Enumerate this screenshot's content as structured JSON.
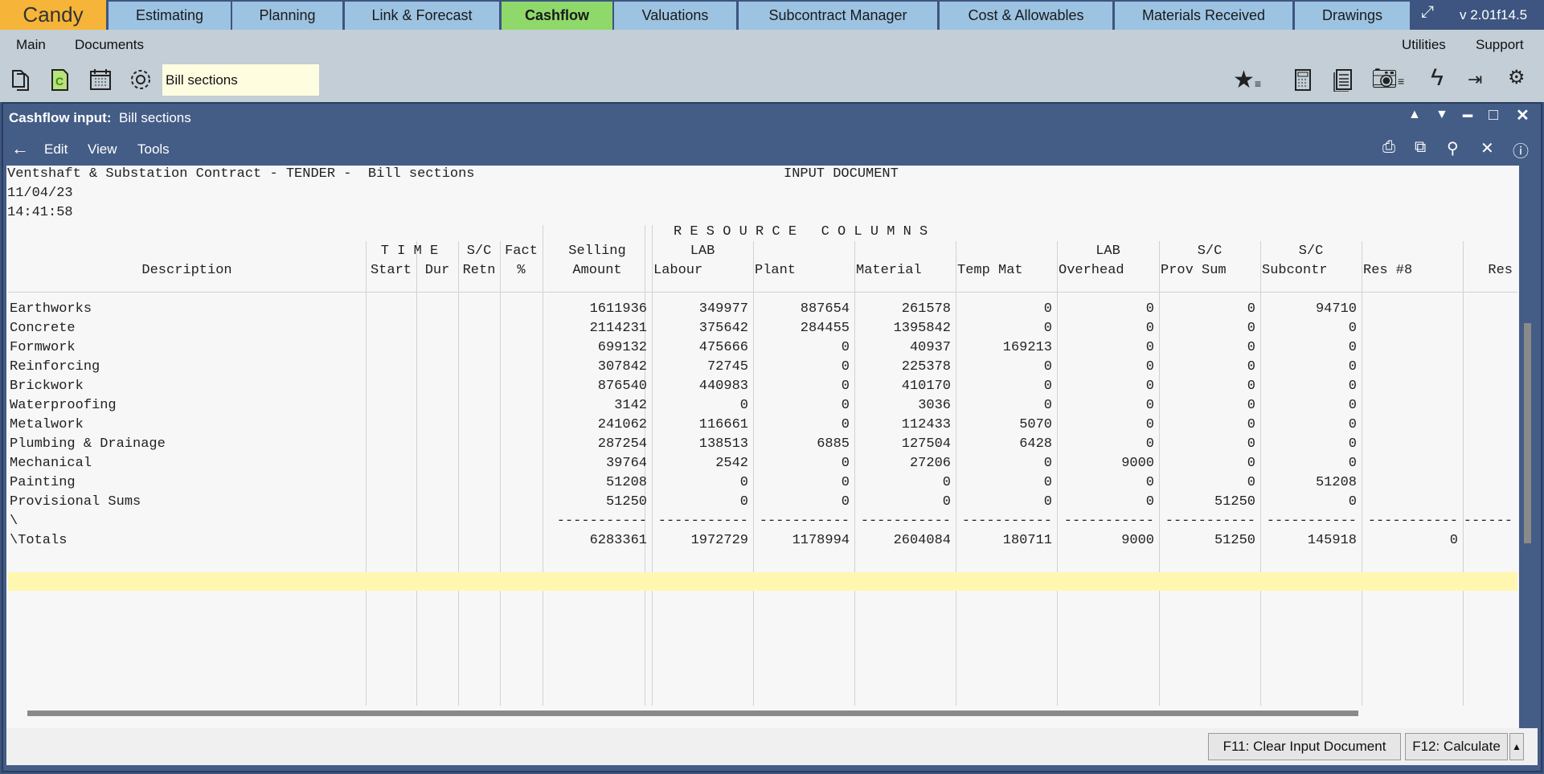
{
  "app": {
    "brand": "Candy",
    "version": "v 2.01f14.5",
    "tabs": [
      {
        "label": "Estimating"
      },
      {
        "label": "Planning"
      },
      {
        "label": "Link & Forecast"
      },
      {
        "label": "Cashflow",
        "active": true
      },
      {
        "label": "Valuations"
      },
      {
        "label": "Subcontract Manager"
      },
      {
        "label": "Cost & Allowables"
      },
      {
        "label": "Materials Received"
      },
      {
        "label": "Drawings"
      }
    ]
  },
  "menubar": {
    "left": [
      "Main",
      "Documents"
    ],
    "right": [
      "Utilities",
      "Support"
    ]
  },
  "toolbar": {
    "document_selector": "Bill sections",
    "left_icons": [
      "copy-pages-icon",
      "cashflow-doc-icon",
      "calendar-icon",
      "settings-gear-icon"
    ],
    "right_icons": [
      "favourites-star-icon",
      "calculator-icon",
      "report-icon",
      "camera-icon",
      "lightning-icon",
      "transfer-icon",
      "multi-gear-icon"
    ]
  },
  "window": {
    "title_label": "Cashflow input:",
    "title_value": "Bill sections",
    "menu": [
      "Edit",
      "View",
      "Tools"
    ]
  },
  "document": {
    "heading": "Ventshaft & Substation Contract - TENDER -  Bill sections",
    "doc_type": "INPUT DOCUMENT",
    "date": "11/04/23",
    "time": "14:41:58",
    "resource_banner": "R E S O U R C E   C O L U M N S",
    "header_top": [
      "",
      "T I M E",
      "",
      "S/C",
      "Fact",
      "Selling",
      "LAB",
      "",
      "",
      "",
      "LAB",
      "S/C",
      "S/C",
      "",
      ""
    ],
    "header_bottom": [
      "Description",
      "Start",
      "Dur",
      "Retn",
      "%",
      "Amount",
      "Labour",
      "Plant",
      "Material",
      "Temp Mat",
      "Overhead",
      "Prov Sum",
      "Subcontr",
      "Res #8",
      "Res"
    ],
    "rows": [
      [
        "Earthworks",
        "",
        "",
        "",
        "",
        "1611936",
        "349977",
        "887654",
        "261578",
        "0",
        "0",
        "0",
        "94710",
        "",
        ""
      ],
      [
        "Concrete",
        "",
        "",
        "",
        "",
        "2114231",
        "375642",
        "284455",
        "1395842",
        "0",
        "0",
        "0",
        "0",
        "",
        ""
      ],
      [
        "Formwork",
        "",
        "",
        "",
        "",
        "699132",
        "475666",
        "0",
        "40937",
        "169213",
        "0",
        "0",
        "0",
        "",
        ""
      ],
      [
        "Reinforcing",
        "",
        "",
        "",
        "",
        "307842",
        "72745",
        "0",
        "225378",
        "0",
        "0",
        "0",
        "0",
        "",
        ""
      ],
      [
        "Brickwork",
        "",
        "",
        "",
        "",
        "876540",
        "440983",
        "0",
        "410170",
        "0",
        "0",
        "0",
        "0",
        "",
        ""
      ],
      [
        "Waterproofing",
        "",
        "",
        "",
        "",
        "3142",
        "0",
        "0",
        "3036",
        "0",
        "0",
        "0",
        "0",
        "",
        ""
      ],
      [
        "Metalwork",
        "",
        "",
        "",
        "",
        "241062",
        "116661",
        "0",
        "112433",
        "5070",
        "0",
        "0",
        "0",
        "",
        ""
      ],
      [
        "Plumbing & Drainage",
        "",
        "",
        "",
        "",
        "287254",
        "138513",
        "6885",
        "127504",
        "6428",
        "0",
        "0",
        "0",
        "",
        ""
      ],
      [
        "Mechanical",
        "",
        "",
        "",
        "",
        "39764",
        "2542",
        "0",
        "27206",
        "0",
        "9000",
        "0",
        "0",
        "",
        ""
      ],
      [
        "Painting",
        "",
        "",
        "",
        "",
        "51208",
        "0",
        "0",
        "0",
        "0",
        "0",
        "0",
        "51208",
        "",
        ""
      ],
      [
        "Provisional Sums",
        "",
        "",
        "",
        "",
        "51250",
        "0",
        "0",
        "0",
        "0",
        "0",
        "51250",
        "0",
        "",
        ""
      ],
      [
        "\\",
        "",
        "",
        "",
        "",
        "-----------",
        "-----------",
        "-----------",
        "-----------",
        "-----------",
        "-----------",
        "-----------",
        "-----------",
        "-----------",
        "------"
      ],
      [
        "\\Totals",
        "",
        "",
        "",
        "",
        "6283361",
        "1972729",
        "1178994",
        "2604084",
        "180711",
        "9000",
        "51250",
        "145918",
        "0",
        ""
      ]
    ]
  },
  "footer": {
    "clear_button": "F11: Clear Input Document",
    "calculate_button": "F12: Calculate"
  }
}
